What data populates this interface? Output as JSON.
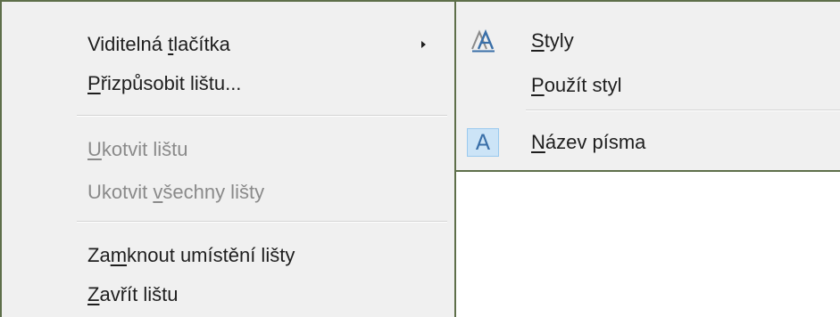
{
  "main_menu": {
    "items": [
      {
        "pre": "Viditelná ",
        "acc": "t",
        "post": "lačítka",
        "disabled": false,
        "submenu": true
      },
      {
        "pre": "",
        "acc": "P",
        "post": "řizpůsobit lištu...",
        "disabled": false,
        "submenu": false
      },
      {
        "pre": "",
        "acc": "U",
        "post": "kotvit lištu",
        "disabled": true,
        "submenu": false
      },
      {
        "pre": "Ukotvit ",
        "acc": "v",
        "post": "šechny lišty",
        "disabled": true,
        "submenu": false
      },
      {
        "pre": "Za",
        "acc": "m",
        "post": "knout umístění lišty",
        "disabled": false,
        "submenu": false
      },
      {
        "pre": "",
        "acc": "Z",
        "post": "avřít lištu",
        "disabled": false,
        "submenu": false
      }
    ]
  },
  "submenu": {
    "items": [
      {
        "pre": "",
        "acc": "S",
        "post": "tyly",
        "icon": "styles-icon"
      },
      {
        "pre": "",
        "acc": "P",
        "post": "oužít styl",
        "icon": ""
      },
      {
        "pre": "",
        "acc": "N",
        "post": "ázev písma",
        "icon": "font-name-icon",
        "icon_glyph": "A"
      }
    ]
  },
  "colors": {
    "menu_background": "#f0f0f0",
    "menu_border": "#5e6f4a",
    "text": "#1e1e1e",
    "disabled_text": "#8a8a8a",
    "icon_highlight": "#cce4f7",
    "icon_accent": "#3a6fa8"
  }
}
